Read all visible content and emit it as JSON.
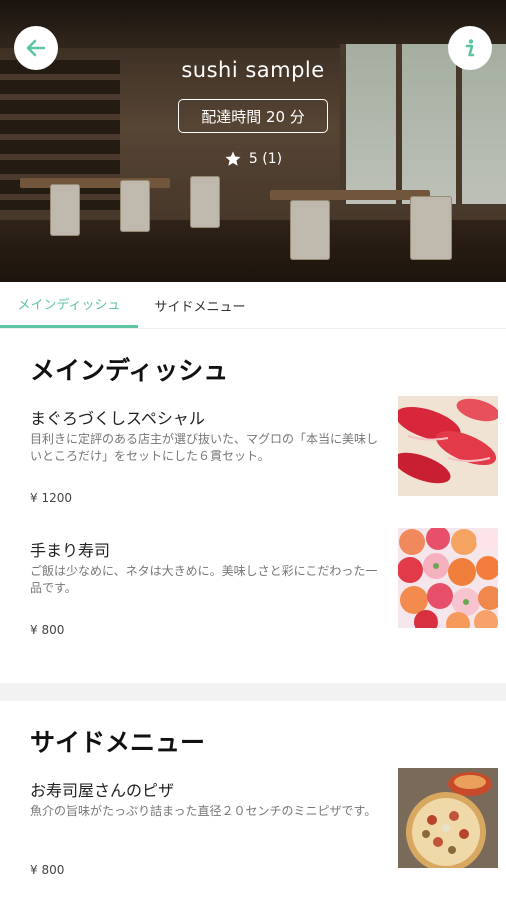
{
  "restaurant": {
    "name": "sushi sample",
    "delivery_time": "配達時間 20 分",
    "rating": "5 (1)"
  },
  "colors": {
    "accent": "#5fc4a2",
    "background": "#f2f2f2"
  },
  "icons": {
    "back": "arrow-left-icon",
    "info": "info-icon",
    "rating": "star-icon"
  },
  "tabs": [
    {
      "label": "メインディッシュ",
      "active": true
    },
    {
      "label": "サイドメニュー",
      "active": false
    }
  ],
  "sections": [
    {
      "title": "メインディッシュ",
      "items": [
        {
          "name": "まぐろづくしスペシャル",
          "description": "目利きに定評のある店主が選び抜いた、マグロの「本当に美味しいところだけ」をセットにした６貫セット。",
          "price": "¥ 1200"
        },
        {
          "name": "手まり寿司",
          "description": "ご飯は少なめに、ネタは大きめに。美味しさと彩にこだわった一品です。",
          "price": "¥ 800"
        }
      ]
    },
    {
      "title": "サイドメニュー",
      "items": [
        {
          "name": "お寿司屋さんのピザ",
          "description": "魚介の旨味がたっぷり詰まった直径２０センチのミニピザです。",
          "price": "¥ 800"
        }
      ]
    }
  ]
}
